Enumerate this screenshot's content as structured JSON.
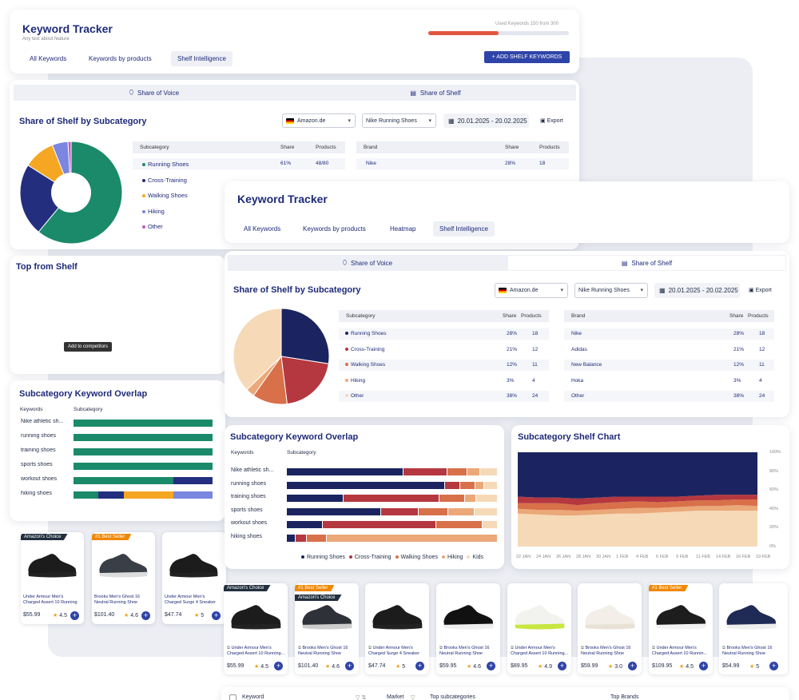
{
  "back": {
    "title": "Keyword Tracker",
    "subtitle": "Any text about feature",
    "used_label": "Used Keywords 150 from 300",
    "used_fraction": 0.5,
    "tabs": [
      "All Keywords",
      "Keywords by products",
      "Shelf Intelligence"
    ],
    "add_button": "+ ADD SHELF KEYWORDS",
    "seg_voice": "Share of Voice",
    "seg_shelf": "Share of Shelf",
    "section_title": "Share of Shelf by Subcategory",
    "market": "Amazon.de",
    "category": "Nike Running Shoes",
    "date_range": "20.01.2025 - 20.02.2025",
    "export": "Export",
    "table_headers": [
      "Subcategory",
      "Share",
      "Products"
    ],
    "rows": [
      {
        "name": "Running Shoes",
        "share": "61%",
        "products": "48/80"
      },
      {
        "name": "Cross-Training",
        "share": "",
        "products": ""
      },
      {
        "name": "Walking Shoes",
        "share": "",
        "products": ""
      },
      {
        "name": "Hiking",
        "share": "",
        "products": ""
      },
      {
        "name": "Other",
        "share": "",
        "products": ""
      }
    ],
    "brand_headers": [
      "Brand",
      "Share",
      "Products"
    ],
    "brand_rows": [
      {
        "name": "Nike",
        "share": "28%",
        "products": "18"
      }
    ],
    "top_title": "Top from Shelf",
    "tooltip": "Add to competitors",
    "products": [
      {
        "badge": "Amazon's Choice",
        "title": "Under Armour Men's Charged Assert 10 Running",
        "price": "$55.99",
        "rating": "4.5"
      },
      {
        "badge": "#1 Best Seller",
        "title": "Brooks Men's Ghost 16 Neutral Running Shoe",
        "price": "$101.40",
        "rating": "4.6"
      },
      {
        "badge": "",
        "title": "Under Armour Men's Charged Surge 4 Sneaker",
        "price": "$47.74",
        "rating": "5"
      }
    ],
    "overlap_title": "Subcategory Keyword Overlap",
    "overlap_headers": [
      "Keywords",
      "Subcategory"
    ],
    "overlap_keywords": [
      "Nike athletic sh...",
      "running shoes",
      "training shoes",
      "sports shoes",
      "workout shoes",
      "hiking shoes"
    ]
  },
  "front": {
    "title": "Keyword Tracker",
    "tabs": [
      "All Keywords",
      "Keywords by products",
      "Heatmap",
      "Shelf Intelligence"
    ],
    "seg_voice": "Share of Voice",
    "seg_shelf": "Share of Shelf",
    "section_title": "Share of Shelf by Subcategory",
    "market": "Amazon.de",
    "category": "Nike Running Shoes",
    "date_range": "20.01.2025 - 20.02.2025",
    "export": "Export",
    "sub_headers": [
      "Subcategory",
      "Share",
      "Products"
    ],
    "sub_rows": [
      {
        "name": "Running Shoes",
        "share": "28%",
        "products": "18",
        "color": "#1b2460"
      },
      {
        "name": "Cross-Training",
        "share": "21%",
        "products": "12",
        "color": "#b5373f"
      },
      {
        "name": "Walking Shoes",
        "share": "12%",
        "products": "11",
        "color": "#d8704a"
      },
      {
        "name": "Hiking",
        "share": "3%",
        "products": "4",
        "color": "#eba878"
      },
      {
        "name": "Other",
        "share": "38%",
        "products": "24",
        "color": "#f6d9b7"
      }
    ],
    "brand_headers": [
      "Brand",
      "Share",
      "Products"
    ],
    "brand_rows": [
      {
        "name": "Nike",
        "share": "28%",
        "products": "18"
      },
      {
        "name": "Adidas",
        "share": "21%",
        "products": "12"
      },
      {
        "name": "New Balance",
        "share": "12%",
        "products": "11"
      },
      {
        "name": "Hoka",
        "share": "3%",
        "products": "4"
      },
      {
        "name": "Other",
        "share": "38%",
        "products": "24"
      }
    ],
    "overlap_title": "Subcategory Keyword Overlap",
    "overlap_headers": [
      "Keywords",
      "Subcategory"
    ],
    "legend": [
      "Running Shoes",
      "Cross-Training",
      "Walking Shoes",
      "Hiking",
      "Kids"
    ],
    "shelf_chart_title": "Subcategory Shelf Chart",
    "shelf_chart_xticks": [
      "22 JAN",
      "24 JAN",
      "26 JAN",
      "28 JAN",
      "30 JAN",
      "1 FEB",
      "4 FEB",
      "6 FEB",
      "9 FEB",
      "11 FEB",
      "14 FEB",
      "16 FEB",
      "19 FEB"
    ],
    "shelf_chart_yticks": [
      "100%",
      "80%",
      "60%",
      "40%",
      "20%",
      "0%"
    ],
    "products": [
      {
        "badge": "Amazon's Choice",
        "title": "Under Armour Men's Charged Assert 10 Running...",
        "price": "$55.99",
        "rating": "4.5"
      },
      {
        "badge": "#1 Best Seller",
        "badge2": "Amazon's Choice",
        "title": "Brooks Men's Ghost 16 Neutral Running Shoe",
        "price": "$101.40",
        "rating": "4.6"
      },
      {
        "badge": "",
        "title": "Under Armour Men's Charged Surge 4 Sneaker",
        "price": "$47.74",
        "rating": "5"
      },
      {
        "badge": "",
        "title": "Brooks Men's Ghost 16 Neutral Running Shoe",
        "price": "$59.95",
        "rating": "4.6"
      },
      {
        "badge": "",
        "title": "Under Armour Men's Charged Assert 10 Running...",
        "price": "$89.95",
        "rating": "4.9"
      },
      {
        "badge": "",
        "title": "Brooks Men's Ghost 16 Neutral Running Shoe",
        "price": "$59.99",
        "rating": "3.0"
      },
      {
        "badge": "#1 Best Seller",
        "title": "Under Armour Men's Charged Assert 10 Runnin...",
        "price": "$109.95",
        "rating": "4.5"
      },
      {
        "badge": "",
        "title": "Brooks Men's Ghost 16 Neutral Running Shoe",
        "price": "$54.99",
        "rating": "5"
      }
    ],
    "bottom_headers": [
      "Keyword",
      "Market",
      "Top subcategories",
      "Top Brands"
    ]
  },
  "chart_data": [
    {
      "type": "pie",
      "title": "Share of Shelf by Subcategory",
      "categories": [
        "Running Shoes",
        "Cross-Training",
        "Walking Shoes",
        "Hiking",
        "Other"
      ],
      "values": [
        28,
        21,
        12,
        3,
        38
      ],
      "colors": [
        "#1b2460",
        "#b5373f",
        "#d8704a",
        "#eba878",
        "#f6d9b7"
      ]
    },
    {
      "type": "pie",
      "title": "Share of Shelf by Subcategory",
      "categories": [
        "Running Shoes",
        "Cross-Training",
        "Walking Shoes",
        "Hiking",
        "Other"
      ],
      "values": [
        61,
        23,
        10,
        5,
        1
      ],
      "colors": [
        "#1a8a6a",
        "#232f7e",
        "#f5a623",
        "#7a86e0",
        "#c05bc0"
      ]
    },
    {
      "type": "bar",
      "title": "Subcategory Keyword Overlap",
      "stacked": true,
      "categories": [
        "Nike athletic sh...",
        "running shoes",
        "training shoes",
        "sports shoes",
        "workout shoes",
        "hiking shoes"
      ],
      "series": [
        {
          "name": "Running Shoes",
          "values": [
            56,
            76,
            27,
            45,
            17,
            4
          ]
        },
        {
          "name": "Cross-Training",
          "values": [
            21,
            7,
            46,
            18,
            54,
            5
          ]
        },
        {
          "name": "Walking Shoes",
          "values": [
            9,
            7,
            12,
            14,
            22,
            9
          ]
        },
        {
          "name": "Hiking",
          "values": [
            6,
            4,
            5,
            12,
            0,
            82
          ]
        },
        {
          "name": "Kids",
          "values": [
            8,
            6,
            10,
            11,
            7,
            0
          ]
        }
      ]
    },
    {
      "type": "area",
      "title": "Subcategory Shelf Chart",
      "stacked": true,
      "ylim": [
        0,
        100
      ],
      "x": [
        "22 JAN",
        "24 JAN",
        "26 JAN",
        "28 JAN",
        "30 JAN",
        "1 FEB",
        "4 FEB",
        "6 FEB",
        "9 FEB",
        "11 FEB",
        "14 FEB",
        "16 FEB",
        "19 FEB"
      ],
      "series": [
        {
          "name": "Kids",
          "values": [
            35,
            34,
            33,
            33,
            34,
            35,
            35,
            36,
            37,
            38,
            38,
            38,
            38
          ]
        },
        {
          "name": "Hiking",
          "values": [
            5,
            5,
            6,
            5,
            5,
            5,
            6,
            5,
            5,
            5,
            5,
            6,
            5
          ]
        },
        {
          "name": "Walking Shoes",
          "values": [
            6,
            7,
            7,
            6,
            7,
            7,
            7,
            6,
            6,
            6,
            6,
            6,
            7
          ]
        },
        {
          "name": "Cross-Training",
          "values": [
            7,
            6,
            6,
            7,
            6,
            6,
            5,
            6,
            5,
            5,
            6,
            5,
            5
          ]
        },
        {
          "name": "Running Shoes",
          "values": [
            47,
            48,
            48,
            49,
            48,
            47,
            47,
            47,
            47,
            46,
            45,
            45,
            45
          ]
        }
      ]
    }
  ]
}
